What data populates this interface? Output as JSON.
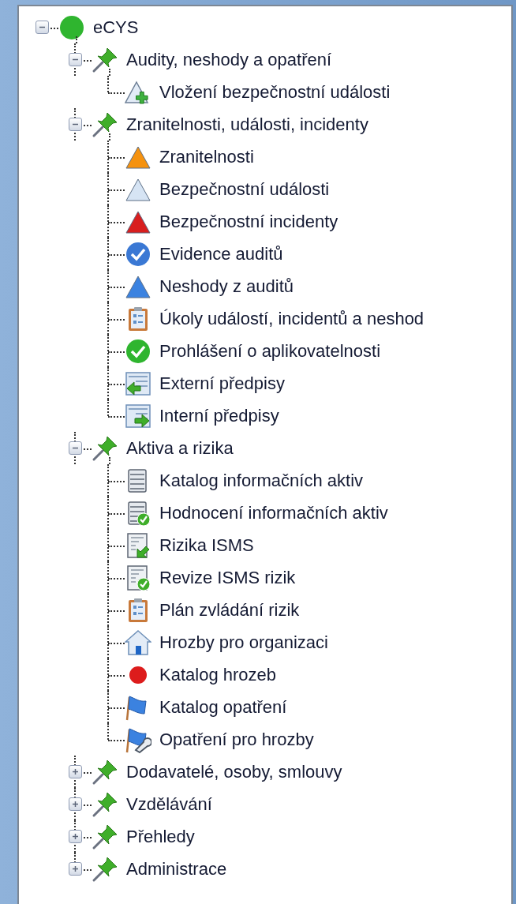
{
  "tree": {
    "label": "eCYS",
    "kind": "dot",
    "color": "#2fb52f",
    "expanded": true,
    "children": [
      {
        "label": "Audity, neshody a opatření",
        "kind": "pin",
        "expanded": true,
        "children": [
          {
            "label": "Vložení bezpečnostní události",
            "kind": "triangle-plus"
          }
        ]
      },
      {
        "label": "Zranitelnosti, události, incidenty",
        "kind": "pin",
        "expanded": true,
        "children": [
          {
            "label": "Zranitelnosti",
            "kind": "triangle",
            "color": "#f5920f"
          },
          {
            "label": "Bezpečnostní události",
            "kind": "triangle",
            "color": "#d6e4f4"
          },
          {
            "label": "Bezpečnostní incidenty",
            "kind": "triangle",
            "color": "#d81e1e"
          },
          {
            "label": "Evidence auditů",
            "kind": "check-circle",
            "color": "#3a78d4"
          },
          {
            "label": "Neshody z auditů",
            "kind": "triangle",
            "color": "#3b82e0"
          },
          {
            "label": "Úkoly událostí, incidentů a neshod",
            "kind": "clipboard"
          },
          {
            "label": "Prohlášení o aplikovatelnosti",
            "kind": "check-circle",
            "color": "#2fb52f"
          },
          {
            "label": "Externí předpisy",
            "kind": "doc-arrow-left"
          },
          {
            "label": "Interní předpisy",
            "kind": "doc-arrow-right"
          }
        ]
      },
      {
        "label": "Aktiva a rizika",
        "kind": "pin",
        "expanded": true,
        "children": [
          {
            "label": "Katalog informačních aktiv",
            "kind": "list"
          },
          {
            "label": "Hodnocení informačních aktiv",
            "kind": "list-check"
          },
          {
            "label": "Rizika ISMS",
            "kind": "sheet-arrow"
          },
          {
            "label": "Revize ISMS rizik",
            "kind": "sheet-check"
          },
          {
            "label": "Plán zvládání rizik",
            "kind": "clipboard"
          },
          {
            "label": "Hrozby pro organizaci",
            "kind": "house"
          },
          {
            "label": "Katalog hrozeb",
            "kind": "dot",
            "color": "#dd1c1c"
          },
          {
            "label": "Katalog opatření",
            "kind": "flag"
          },
          {
            "label": "Opatření pro hrozby",
            "kind": "flag-wrench"
          }
        ]
      },
      {
        "label": "Dodavatelé, osoby, smlouvy",
        "kind": "pin",
        "expanded": false
      },
      {
        "label": "Vzdělávání",
        "kind": "pin",
        "expanded": false
      },
      {
        "label": "Přehledy",
        "kind": "pin",
        "expanded": false
      },
      {
        "label": "Administrace",
        "kind": "pin",
        "expanded": false
      }
    ]
  }
}
